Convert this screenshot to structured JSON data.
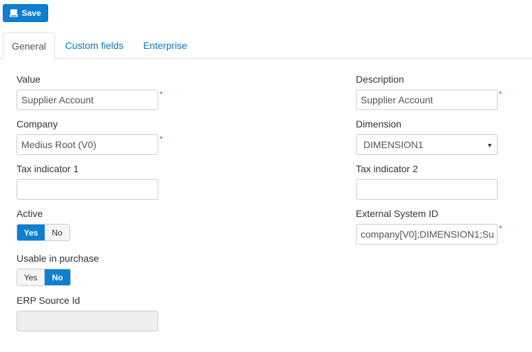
{
  "toolbar": {
    "save_label": "Save"
  },
  "tabs": [
    {
      "label": "General",
      "active": true
    },
    {
      "label": "Custom fields",
      "active": false
    },
    {
      "label": "Enterprise",
      "active": false
    }
  ],
  "form": {
    "value": {
      "label": "Value",
      "value": "Supplier Account",
      "required": true
    },
    "description": {
      "label": "Description",
      "value": "Supplier Account",
      "required": true
    },
    "company": {
      "label": "Company",
      "value": "Medius Root (V0)",
      "required": true
    },
    "dimension": {
      "label": "Dimension",
      "value": "DIMENSION1"
    },
    "tax_indicator_1": {
      "label": "Tax indicator 1",
      "value": ""
    },
    "tax_indicator_2": {
      "label": "Tax indicator 2",
      "value": ""
    },
    "active": {
      "label": "Active",
      "yes": "Yes",
      "no": "No",
      "selected": "Yes"
    },
    "external_system_id": {
      "label": "External System ID",
      "value": "company[V0];DIMENSION1;Su",
      "required": true
    },
    "usable_in_purchase": {
      "label": "Usable in purchase",
      "yes": "Yes",
      "no": "No",
      "selected": "No"
    },
    "erp_source_id": {
      "label": "ERP Source Id",
      "value": ""
    }
  },
  "required_marker": "*",
  "colors": {
    "accent": "#0d7fd2",
    "link": "#0d74c4",
    "required": "#e02020"
  },
  "icons": {
    "save": "floppy-disk-icon",
    "dropdown": "caret-down-icon"
  }
}
